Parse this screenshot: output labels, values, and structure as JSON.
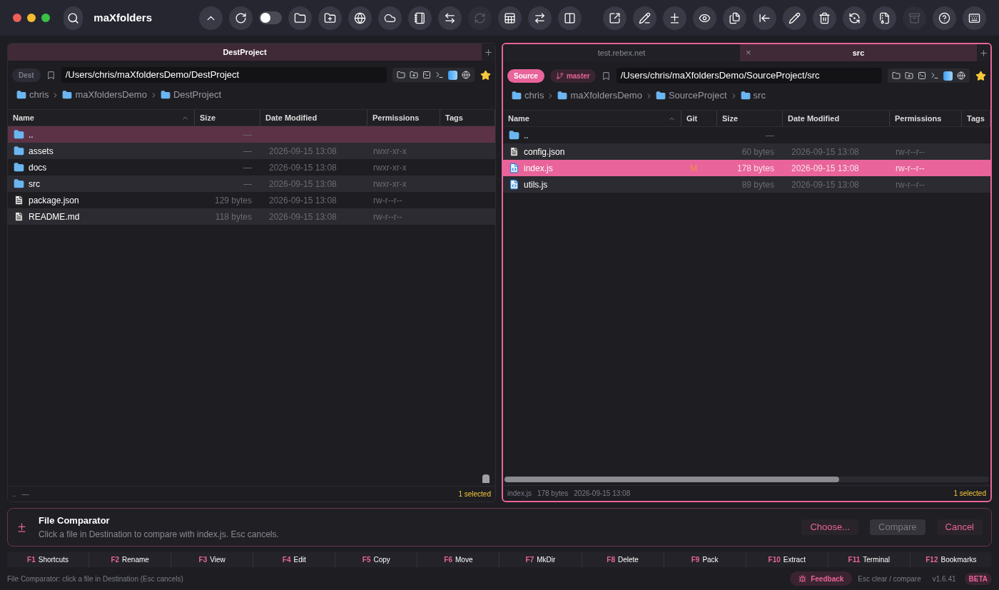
{
  "window": {
    "title": "maXfolders"
  },
  "toolbar": [
    {
      "kind": "up",
      "disabled": false
    },
    {
      "kind": "refresh",
      "disabled": false
    },
    {
      "kind": "toggle",
      "on": false
    },
    {
      "kind": "folder",
      "disabled": false
    },
    {
      "kind": "new-folder",
      "disabled": false
    },
    {
      "kind": "globe",
      "disabled": false
    },
    {
      "kind": "cloud",
      "disabled": false
    },
    {
      "kind": "notes",
      "disabled": false
    },
    {
      "kind": "swap-box",
      "disabled": false
    },
    {
      "kind": "sync",
      "disabled": true
    },
    {
      "kind": "table",
      "disabled": false
    },
    {
      "kind": "swap",
      "disabled": false
    },
    {
      "kind": "columns",
      "disabled": false
    },
    {
      "kind": "gap"
    },
    {
      "kind": "open-external",
      "disabled": false
    },
    {
      "kind": "angle",
      "disabled": false
    },
    {
      "kind": "diff",
      "disabled": false
    },
    {
      "kind": "eye",
      "disabled": false
    },
    {
      "kind": "copy",
      "disabled": false
    },
    {
      "kind": "move-left",
      "disabled": false
    },
    {
      "kind": "pencil",
      "disabled": false
    },
    {
      "kind": "trash",
      "disabled": false
    },
    {
      "kind": "sync-circle",
      "disabled": false
    },
    {
      "kind": "zip",
      "disabled": false
    },
    {
      "kind": "archive",
      "disabled": true
    },
    {
      "kind": "help",
      "disabled": false
    },
    {
      "kind": "keyboard",
      "disabled": false
    }
  ],
  "panels": [
    {
      "active": false,
      "tabs": [
        {
          "label": "DestProject",
          "selected": true
        }
      ],
      "badge": "Dest",
      "path": "/Users/chris/maXfoldersDemo/DestProject",
      "breadcrumbs": [
        "chris",
        "maXfoldersDemo",
        "DestProject"
      ],
      "columns": [
        "Name",
        "Size",
        "Date Modified",
        "Permissions",
        "Tags"
      ],
      "rows": [
        {
          "kind": "folder",
          "name": "..",
          "size": "—",
          "selected": true
        },
        {
          "kind": "folder",
          "name": "assets",
          "size": "—",
          "date": "2026-09-15 13:08",
          "permissions": "rwxr-xr-x",
          "selected": false
        },
        {
          "kind": "folder",
          "name": "docs",
          "size": "—",
          "date": "2026-09-15 13:08",
          "permissions": "rwxr-xr-x",
          "selected": false
        },
        {
          "kind": "folder",
          "name": "src",
          "size": "—",
          "date": "2026-09-15 13:08",
          "permissions": "rwxr-xr-x",
          "selected": false
        },
        {
          "kind": "file",
          "name": "package.json",
          "size": "129 bytes",
          "date": "2026-09-15 13:08",
          "permissions": "rw-r--r--",
          "selected": false
        },
        {
          "kind": "file",
          "name": "README.md",
          "size": "118 bytes",
          "date": "2026-09-15 13:08",
          "permissions": "rw-r--r--",
          "selected": false
        }
      ],
      "footer": {
        "info": [
          "..",
          " —"
        ],
        "selection": "1 selected"
      }
    },
    {
      "active": true,
      "tabs": [
        {
          "label": "test.rebex.net",
          "selected": false
        },
        {
          "label": "src",
          "selected": true,
          "close": "×"
        }
      ],
      "badge": "Source",
      "branch": "master",
      "path": "/Users/chris/maXfoldersDemo/SourceProject/src",
      "breadcrumbs": [
        "chris",
        "maXfoldersDemo",
        "SourceProject",
        "src"
      ],
      "columns": [
        "Name",
        "Git",
        "Size",
        "Date Modified",
        "Permissions",
        "Tags"
      ],
      "rows": [
        {
          "kind": "folder",
          "name": "..",
          "size": "—",
          "selected": false
        },
        {
          "kind": "file",
          "name": "config.json",
          "size": "60 bytes",
          "date": "2026-09-15 13:08",
          "permissions": "rw-r--r--",
          "selected": false
        },
        {
          "kind": "script",
          "name": "index.js",
          "git": "M",
          "size": "178 bytes",
          "date": "2026-09-15 13:08",
          "permissions": "rw-r--r--",
          "selected": true
        },
        {
          "kind": "script",
          "name": "utils.js",
          "size": "89 bytes",
          "date": "2026-09-15 13:08",
          "permissions": "rw-r--r--",
          "selected": false
        }
      ],
      "footer": {
        "info": [
          "index.js",
          "178 bytes",
          "2026-09-15 13:08"
        ],
        "selection": "1 selected"
      }
    }
  ],
  "comparator": {
    "title": "File Comparator",
    "text": "Click a file in Destination to compare with index.js. Esc cancels.",
    "buttons": [
      {
        "label": "Choose...",
        "disabled": false
      },
      {
        "label": "Compare",
        "disabled": true
      },
      {
        "label": "Cancel",
        "disabled": false
      }
    ]
  },
  "function_keys": [
    {
      "key": "F1",
      "label": "Shortcuts"
    },
    {
      "key": "F2",
      "label": "Rename"
    },
    {
      "key": "F3",
      "label": "View"
    },
    {
      "key": "F4",
      "label": "Edit"
    },
    {
      "key": "F5",
      "label": "Copy"
    },
    {
      "key": "F6",
      "label": "Move"
    },
    {
      "key": "F7",
      "label": "MkDir"
    },
    {
      "key": "F8",
      "label": "Delete"
    },
    {
      "key": "F9",
      "label": "Pack"
    },
    {
      "key": "F10",
      "label": "Extract"
    },
    {
      "key": "F11",
      "label": "Terminal"
    },
    {
      "key": "F12",
      "label": "Bookmarks"
    }
  ],
  "status_bar": {
    "message": "File Comparator: click a file in Destination (Esc cancels)",
    "feedback": "Feedback",
    "hint": "Esc clear / compare",
    "version": "v1.6.41",
    "badge": "BETA"
  }
}
